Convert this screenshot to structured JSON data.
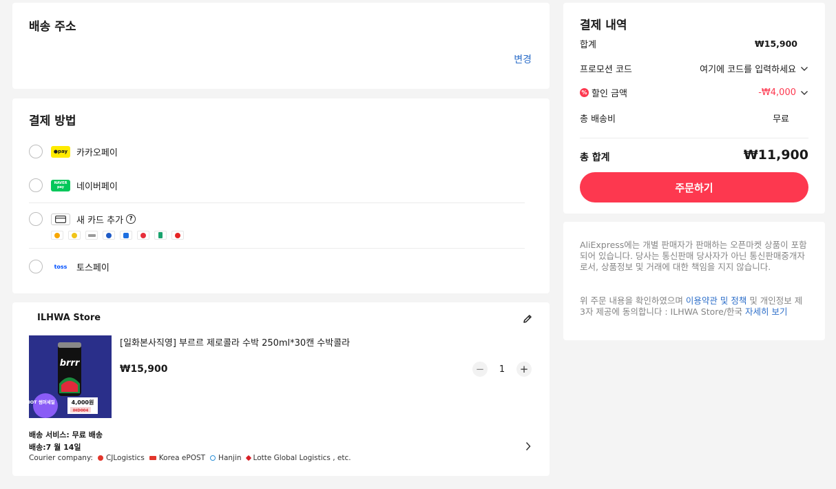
{
  "address": {
    "title": "배송 주소",
    "change_label": "변경"
  },
  "payment": {
    "title": "결제 방법",
    "methods": [
      {
        "label": "카카오페이",
        "logo_text": "●pay",
        "logo_bg": "#ffeb00",
        "logo_color": "#191919"
      },
      {
        "label": "네이버페이",
        "logo_text": "NAVER pay",
        "logo_bg": "#03c75a",
        "logo_color": "#ffffff"
      },
      {
        "label": "새 카드 추가",
        "help": "?"
      },
      {
        "label": "토스페이",
        "logo_text": "toss",
        "logo_bg": "#ffffff",
        "logo_color": "#0050ff"
      }
    ],
    "card_brand_colors": [
      "#f7a600",
      "#f0c419",
      "#9a9a9a",
      "#1f5bc6",
      "#1d6fe0",
      "#e62e3a",
      "#1aa36e",
      "#e52424"
    ]
  },
  "store": {
    "name": "ILHWA Store",
    "item": {
      "title": "[일화본사직영] 부르르 제로콜라 수박 250ml*30캔 수박콜라",
      "price": "₩15,900",
      "quantity": "1",
      "thumb": {
        "brand": "brrr",
        "badge": "HOT 썸머세일",
        "price_tag": "4,000원",
        "coupon": "IHD004"
      }
    },
    "shipping_service": "배송 서비스: 무료 배송",
    "shipping_date": "배송:7 월 14일",
    "courier_label": "Courier company:",
    "couriers": [
      {
        "name": "CJLogistics",
        "color": "#e2362c"
      },
      {
        "name": "Korea ePOST",
        "color": "#e2362c"
      },
      {
        "name": "Hanjin",
        "color": "#2b8fd6"
      },
      {
        "name": "Lotte Global Logistics , etc.",
        "color": "#d81f26"
      }
    ]
  },
  "summary": {
    "title": "결제 내역",
    "subtotal_label": "합계",
    "subtotal_value": "₩15,900",
    "promo_label": "프로모션 코드",
    "promo_placeholder": "여기에 코드를 입력하세요",
    "discount_label": "할인 금액",
    "discount_value": "-₩4,000",
    "shipping_label": "총 배송비",
    "shipping_value": "무료",
    "total_label": "총 합계",
    "total_value": "₩11,900",
    "order_button": "주문하기"
  },
  "notice": {
    "paragraph1": "AliExpress에는 개별 판매자가 판매하는 오픈마켓 상품이 포함되어 있습니다. 당사는 통신판매 당사자가 아닌 통신판매중개자로서, 상품정보 및 거래에 대한 책임을 지지 않습니다.",
    "p2_prefix": "위 주문 내용을 확인하였으며 ",
    "terms_link": "이용약관 및 정책",
    "p2_middle": " 및 개인정보 제3자 제공에 동의합니다 : ILHWA Store/한국 ",
    "details_link": "자세히 보기"
  },
  "colors": {
    "accent": "#fd384f",
    "link": "#2c6ec9",
    "background": "#f4f4f4"
  }
}
